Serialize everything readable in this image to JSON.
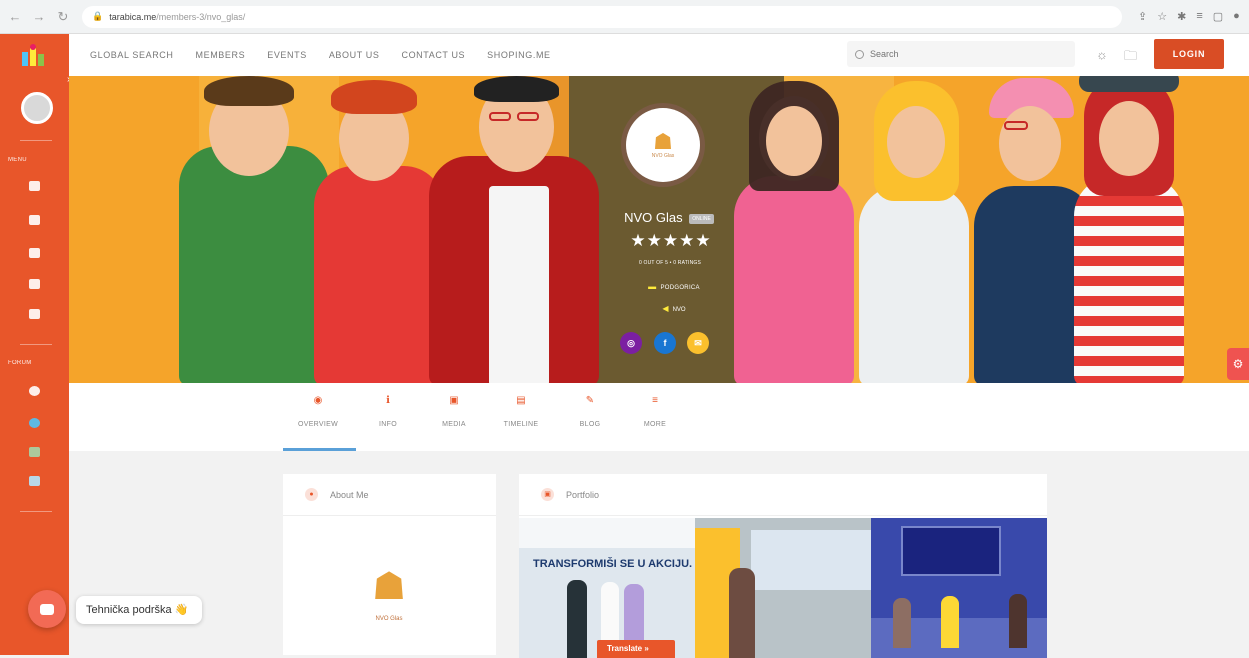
{
  "browser": {
    "url_host": "tarabica.me",
    "url_path": "/members-3/nvo_glas/"
  },
  "sidebar": {
    "menu_label": "MENU",
    "forum_label": "FORUM"
  },
  "nav": {
    "links": [
      "GLOBAL SEARCH",
      "MEMBERS",
      "EVENTS",
      "ABOUT US",
      "CONTACT US",
      "SHOPING.ME"
    ],
    "search_placeholder": "Search",
    "login_label": "LOGIN"
  },
  "profile": {
    "name": "NVO Glas",
    "status_badge": "ONLINE",
    "stars": "★★★★★",
    "ratings_text": "0 OUT OF 5  •  0 RATINGS",
    "location": "PODGORICA",
    "category": "NVO",
    "logo_text": "NVO Glas"
  },
  "tabs": [
    {
      "label": "OVERVIEW",
      "icon": "◉"
    },
    {
      "label": "INFO",
      "icon": "ℹ"
    },
    {
      "label": "MEDIA",
      "icon": "▣"
    },
    {
      "label": "TIMELINE",
      "icon": "▤"
    },
    {
      "label": "BLOG",
      "icon": "✎"
    },
    {
      "label": "MORE",
      "icon": "≡"
    }
  ],
  "about": {
    "title": "About Me",
    "logo_text": "NVO Glas"
  },
  "portfolio": {
    "title": "Portfolio",
    "photo_text": "TRANSFORMIŠI SE U AKCIJU.",
    "translate_label": "Translate »"
  },
  "support": {
    "label": "Tehnička podrška 👋"
  },
  "colors": {
    "accent": "#e8562a",
    "cover_bg": "#f5a42a",
    "login": "#d94d25"
  }
}
